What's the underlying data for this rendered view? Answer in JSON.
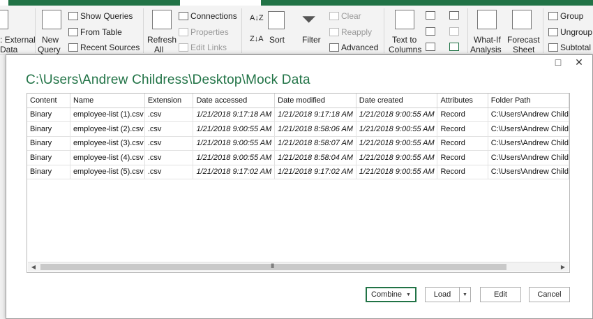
{
  "ribbon": {
    "get_external_label": ": External",
    "get_external_sub": "Data",
    "new_query_label": "New",
    "new_query_sub": "Query",
    "show_queries": "Show Queries",
    "from_table": "From Table",
    "recent_sources": "Recent Sources",
    "refresh_label": "Refresh",
    "refresh_sub": "All",
    "connections": "Connections",
    "properties": "Properties",
    "edit_links": "Edit Links",
    "sort": "Sort",
    "filter": "Filter",
    "clear": "Clear",
    "reapply": "Reapply",
    "advanced": "Advanced",
    "text_to_columns_label": "Text to",
    "text_to_columns_sub": "Columns",
    "whatif_label": "What-If",
    "whatif_sub": "Analysis",
    "forecast_label": "Forecast",
    "forecast_sub": "Sheet",
    "group": "Group",
    "ungroup": "Ungroup",
    "subtotal": "Subtotal"
  },
  "dialog": {
    "title": "C:\\Users\\Andrew Childress\\Desktop\\Mock Data",
    "maximize_icon": "□",
    "close_icon": "✕"
  },
  "grid": {
    "headers": [
      "Content",
      "Name",
      "Extension",
      "Date accessed",
      "Date modified",
      "Date created",
      "Attributes",
      "Folder Path"
    ],
    "rows": [
      [
        "Binary",
        "employee-list (1).csv",
        ".csv",
        "1/21/2018 9:17:18 AM",
        "1/21/2018 9:17:18 AM",
        "1/21/2018 9:00:55 AM",
        "Record",
        "C:\\Users\\Andrew Child"
      ],
      [
        "Binary",
        "employee-list (2).csv",
        ".csv",
        "1/21/2018 9:00:55 AM",
        "1/21/2018 8:58:06 AM",
        "1/21/2018 9:00:55 AM",
        "Record",
        "C:\\Users\\Andrew Child"
      ],
      [
        "Binary",
        "employee-list (3).csv",
        ".csv",
        "1/21/2018 9:00:55 AM",
        "1/21/2018 8:58:07 AM",
        "1/21/2018 9:00:55 AM",
        "Record",
        "C:\\Users\\Andrew Child"
      ],
      [
        "Binary",
        "employee-list (4).csv",
        ".csv",
        "1/21/2018 9:00:55 AM",
        "1/21/2018 8:58:04 AM",
        "1/21/2018 9:00:55 AM",
        "Record",
        "C:\\Users\\Andrew Child"
      ],
      [
        "Binary",
        "employee-list (5).csv",
        ".csv",
        "1/21/2018 9:17:02 AM",
        "1/21/2018 9:17:02 AM",
        "1/21/2018 9:00:55 AM",
        "Record",
        "C:\\Users\\Andrew Child"
      ]
    ],
    "scroll_grip": "III"
  },
  "buttons": {
    "combine": "Combine",
    "load": "Load",
    "edit": "Edit",
    "cancel": "Cancel"
  },
  "colors": {
    "accent": "#217346",
    "ribbon_bg": "#f3f3f3"
  }
}
